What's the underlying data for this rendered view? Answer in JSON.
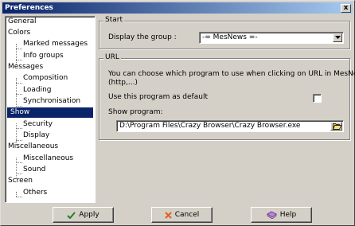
{
  "window": {
    "title": "Preferences",
    "close_symbol": "x"
  },
  "tree": {
    "items": [
      {
        "label": "General",
        "level": 0,
        "selected": false
      },
      {
        "label": "Colors",
        "level": 0,
        "selected": false
      },
      {
        "label": "Marked messages",
        "level": 1,
        "selected": false
      },
      {
        "label": "Info groups",
        "level": 1,
        "selected": false
      },
      {
        "label": "Messages",
        "level": 0,
        "selected": false
      },
      {
        "label": "Composition",
        "level": 1,
        "selected": false
      },
      {
        "label": "Loading",
        "level": 1,
        "selected": false
      },
      {
        "label": "Synchronisation",
        "level": 1,
        "selected": false
      },
      {
        "label": "Show",
        "level": 0,
        "selected": true
      },
      {
        "label": "Security",
        "level": 1,
        "selected": false
      },
      {
        "label": "Display",
        "level": 1,
        "selected": false
      },
      {
        "label": "Miscellaneous",
        "level": 0,
        "selected": false
      },
      {
        "label": "Miscellaneous",
        "level": 1,
        "selected": false
      },
      {
        "label": "Sound",
        "level": 1,
        "selected": false
      },
      {
        "label": "Screen",
        "level": 0,
        "selected": false
      },
      {
        "label": "Others",
        "level": 1,
        "selected": false
      }
    ]
  },
  "start": {
    "title": "Start",
    "display_group_label": "Display the group :",
    "display_group_value": "-= MesNews =-"
  },
  "url": {
    "title": "URL",
    "description_line1": "You can choose which program to use when clicking on URL in MesNews",
    "description_line2": "(http,...)",
    "default_label": "Use this program as default",
    "default_checked": false,
    "show_program_label": "Show program:",
    "program_path": "D:\\Program Files\\Crazy Browser\\Crazy Browser.exe"
  },
  "buttons": {
    "apply": "Apply",
    "cancel": "Cancel",
    "help": "Help"
  },
  "colors": {
    "titlebar_start": "#0a246a",
    "titlebar_end": "#a6caf0",
    "selection": "#0a246a",
    "face": "#d4d0c8"
  }
}
